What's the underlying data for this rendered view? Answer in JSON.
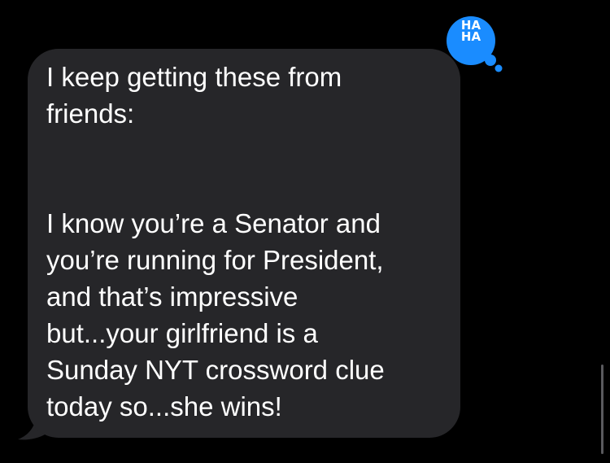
{
  "message": {
    "paragraph1": [
      "I keep getting these from",
      "friends:"
    ],
    "paragraph2": [
      "I know you’re a Senator and",
      "you’re running for President,",
      "and that’s impressive",
      "but...your girlfriend is a",
      "Sunday NYT crossword clue",
      "today so...she wins!"
    ]
  },
  "tapback": {
    "line1": "HA",
    "line2": "HA",
    "icon": "haha-tapback-icon"
  },
  "colors": {
    "background": "#000000",
    "bubble": "#262629",
    "text": "#ffffff",
    "tapback": "#1a8cff"
  }
}
